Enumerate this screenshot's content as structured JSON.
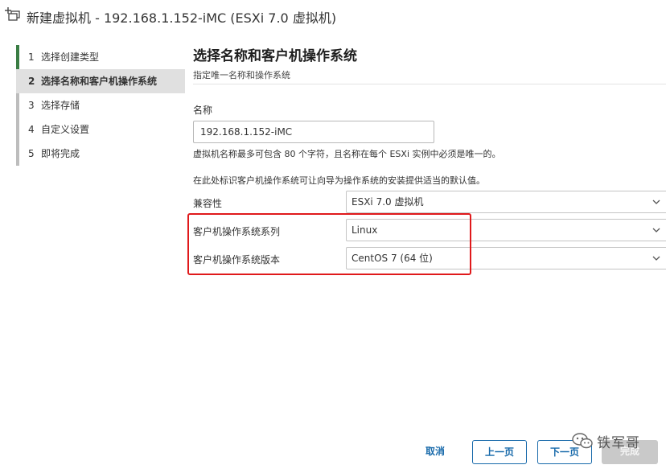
{
  "window": {
    "title": "新建虚拟机 - 192.168.1.152-iMC (ESXi 7.0 虚拟机)"
  },
  "steps": [
    {
      "num": "1",
      "label": "选择创建类型"
    },
    {
      "num": "2",
      "label": "选择名称和客户机操作系统"
    },
    {
      "num": "3",
      "label": "选择存储"
    },
    {
      "num": "4",
      "label": "自定义设置"
    },
    {
      "num": "5",
      "label": "即将完成"
    }
  ],
  "main": {
    "title": "选择名称和客户机操作系统",
    "subtitle": "指定唯一名称和操作系统",
    "name_label": "名称",
    "name_value": "192.168.1.152-iMC",
    "name_help": "虚拟机名称最多可包含 80 个字符，且名称在每个 ESXi 实例中必须是唯一的。",
    "os_help": "在此处标识客户机操作系统可让向导为操作系统的安装提供适当的默认值。",
    "compat_label": "兼容性",
    "compat_value": "ESXi 7.0 虚拟机",
    "family_label": "客户机操作系统系列",
    "family_value": "Linux",
    "version_label": "客户机操作系统版本",
    "version_value": "CentOS 7 (64 位)"
  },
  "buttons": {
    "cancel": "取消",
    "prev": "上一页",
    "next": "下一页",
    "finish": "完成"
  },
  "watermark": {
    "text": "铁军哥"
  },
  "colors": {
    "accent": "#1769aa",
    "active_step": "#3a7d44",
    "highlight": "#e0191b"
  }
}
